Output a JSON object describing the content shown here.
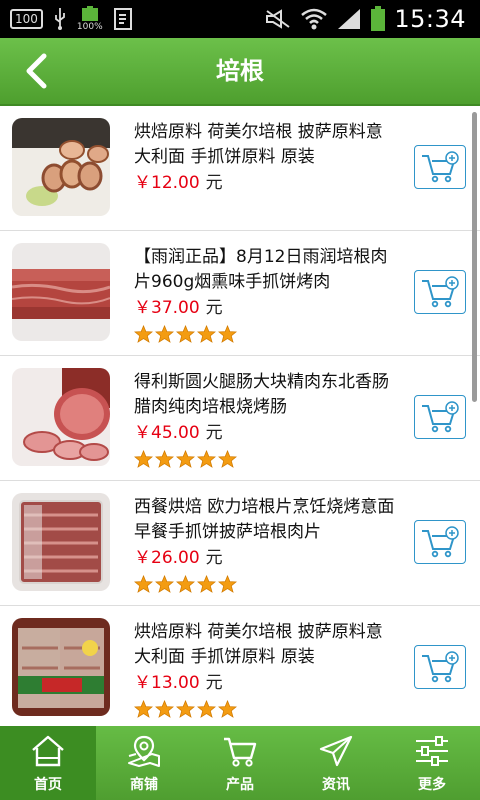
{
  "status_bar": {
    "left_box": "100",
    "battery_pct": "100%",
    "time": "15:34"
  },
  "header": {
    "title": "培根",
    "back_icon": "chevron-left-icon"
  },
  "products": [
    {
      "name": "烘焙原料 荷美尔培根 披萨原料意大利面 手抓饼原料 原装",
      "price": "￥12.00",
      "unit": "元",
      "rating": 0
    },
    {
      "name": "【雨润正品】8月12日雨润培根肉片960g烟熏味手抓饼烤肉",
      "price": "￥37.00",
      "unit": "元",
      "rating": 5
    },
    {
      "name": "得利斯圆火腿肠大块精肉东北香肠腊肉纯肉培根烧烤肠",
      "price": "￥45.00",
      "unit": "元",
      "rating": 5
    },
    {
      "name": "西餐烘焙 欧力培根片烹饪烧烤意面早餐手抓饼披萨培根肉片",
      "price": "￥26.00",
      "unit": "元",
      "rating": 5
    },
    {
      "name": "烘焙原料 荷美尔培根 披萨原料意大利面 手抓饼原料 原装",
      "price": "￥13.00",
      "unit": "元",
      "rating": 5
    }
  ],
  "tabs": [
    {
      "label": "首页",
      "icon": "home-icon",
      "active": true
    },
    {
      "label": "商铺",
      "icon": "map-icon",
      "active": false
    },
    {
      "label": "产品",
      "icon": "cart-icon",
      "active": false
    },
    {
      "label": "资讯",
      "icon": "send-icon",
      "active": false
    },
    {
      "label": "更多",
      "icon": "sliders-icon",
      "active": false
    }
  ],
  "colors": {
    "accent_green": "#5aae38",
    "price_red": "#e60012",
    "cart_blue": "#2f95c9",
    "star_orange": "#f39c12"
  }
}
